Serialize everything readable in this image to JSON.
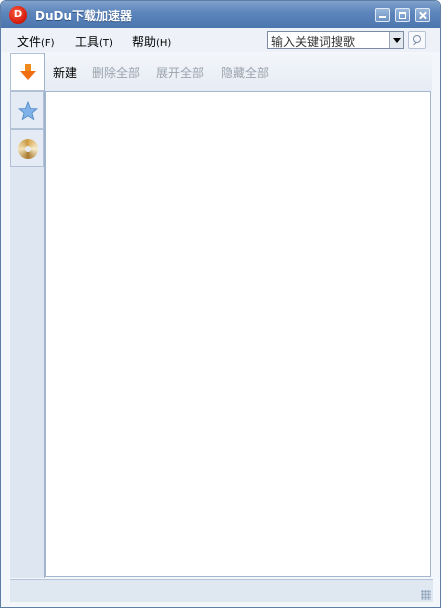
{
  "window": {
    "title": "DuDu下载加速器",
    "app_icon_letter": "D",
    "controls": [
      "minimize",
      "maximize",
      "close"
    ]
  },
  "menu": {
    "file": {
      "label": "文件",
      "key": "(F)"
    },
    "tools": {
      "label": "工具",
      "key": "(T)"
    },
    "help": {
      "label": "帮助",
      "key": "(H)"
    }
  },
  "search": {
    "placeholder": "输入关键词搜歌",
    "button_icon": "search-icon"
  },
  "sidebar": {
    "tabs": [
      {
        "icon": "download-arrow-icon",
        "active": true
      },
      {
        "icon": "star-icon",
        "active": false
      },
      {
        "icon": "disc-icon",
        "active": false
      }
    ]
  },
  "toolbar": {
    "new_label": "新建",
    "delete_all_label": "删除全部",
    "expand_all_label": "展开全部",
    "hide_all_label": "隐藏全部"
  },
  "colors": {
    "titlebar": "#5b84bb",
    "accent_orange": "#f08a1c",
    "disabled_text": "#9aa3ae"
  }
}
